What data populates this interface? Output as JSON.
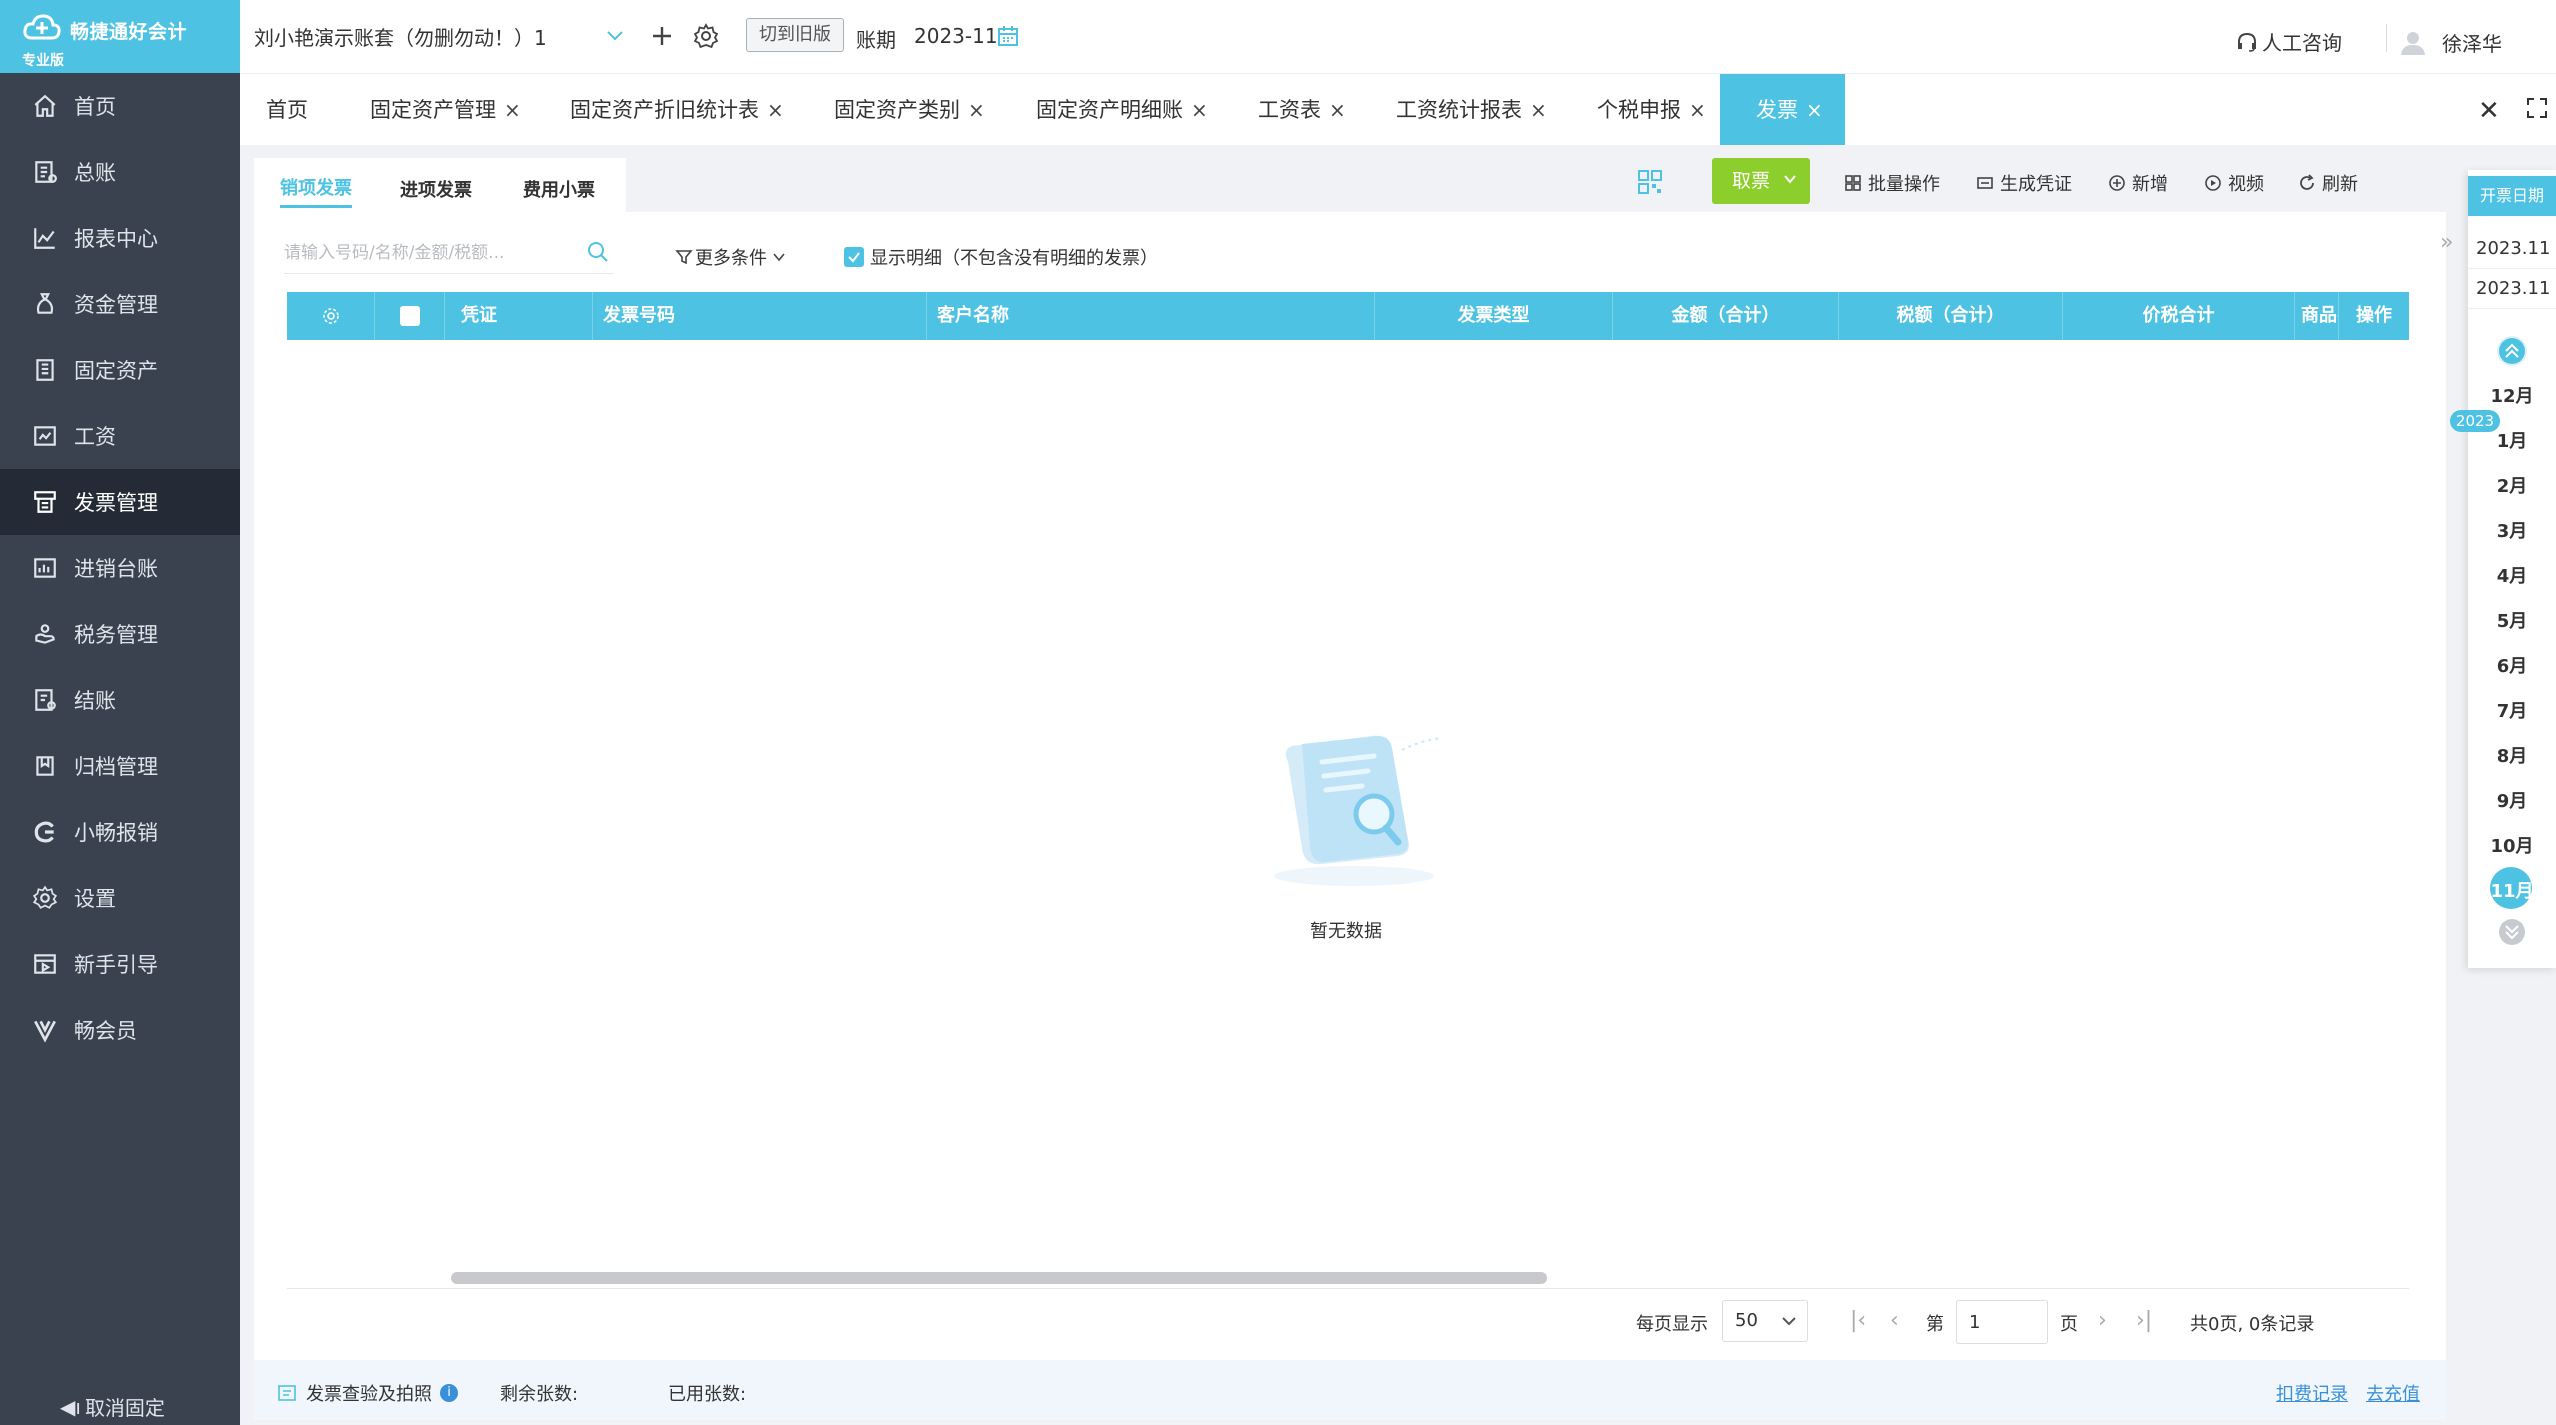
{
  "logo": {
    "name": "畅捷通好会计",
    "edition": "专业版"
  },
  "sidebar": {
    "items": [
      {
        "label": "首页",
        "icon": "home-icon"
      },
      {
        "label": "总账",
        "icon": "ledger-icon"
      },
      {
        "label": "报表中心",
        "icon": "report-chart-icon"
      },
      {
        "label": "资金管理",
        "icon": "money-bag-icon"
      },
      {
        "label": "固定资产",
        "icon": "building-icon"
      },
      {
        "label": "工资",
        "icon": "salary-icon"
      },
      {
        "label": "发票管理",
        "icon": "invoice-icon",
        "active": true
      },
      {
        "label": "进销台账",
        "icon": "inventory-icon"
      },
      {
        "label": "税务管理",
        "icon": "tax-hand-icon"
      },
      {
        "label": "结账",
        "icon": "checkout-icon"
      },
      {
        "label": "归档管理",
        "icon": "archive-icon"
      },
      {
        "label": "小畅报销",
        "icon": "reimburse-icon"
      },
      {
        "label": "设置",
        "icon": "gear-icon"
      },
      {
        "label": "新手引导",
        "icon": "guide-icon"
      },
      {
        "label": "畅会员",
        "icon": "vip-icon"
      }
    ],
    "unpin_label": "取消固定"
  },
  "topbar": {
    "account": "刘小艳演示账套（勿删勿动！）1",
    "switch_old": "切到旧版",
    "period_label": "账期",
    "period_value": "2023-11",
    "support": "人工咨询",
    "user": "徐泽华"
  },
  "tabs": [
    {
      "label": "首页",
      "closable": false
    },
    {
      "label": "固定资产管理",
      "closable": true
    },
    {
      "label": "固定资产折旧统计表",
      "closable": true
    },
    {
      "label": "固定资产类别",
      "closable": true
    },
    {
      "label": "固定资产明细账",
      "closable": true
    },
    {
      "label": "工资表",
      "closable": true
    },
    {
      "label": "工资统计报表",
      "closable": true
    },
    {
      "label": "个税申报",
      "closable": true
    },
    {
      "label": "发票",
      "closable": true,
      "active": true
    }
  ],
  "subtabs": [
    {
      "label": "销项发票",
      "active": true
    },
    {
      "label": "进项发票"
    },
    {
      "label": "费用小票"
    }
  ],
  "toolbar": {
    "fetch": "取票",
    "batch": "批量操作",
    "voucher": "生成凭证",
    "add": "新增",
    "video": "视频",
    "refresh": "刷新"
  },
  "filters": {
    "search_placeholder": "请输入号码/名称/金额/税额...",
    "more": "更多条件",
    "show_detail": "显示明细（不包含没有明细的发票）",
    "show_detail_checked": true
  },
  "table": {
    "columns": [
      "凭证",
      "发票号码",
      "客户名称",
      "发票类型",
      "金额（合计）",
      "税额（合计）",
      "价税合计",
      "商品名",
      "操作"
    ],
    "empty_text": "暂无数据"
  },
  "pager": {
    "per_page_label": "每页显示",
    "per_page": "50",
    "page_prefix": "第",
    "page_value": "1",
    "page_suffix": "页",
    "summary": "共0页, 0条记录"
  },
  "footer": {
    "check": "发票查验及拍照",
    "remaining": "剩余张数:",
    "used": "已用张数:",
    "deduct_record": "扣费记录",
    "recharge": "去充值"
  },
  "date_panel": {
    "title": "开票日期",
    "range_start": "2023.11",
    "range_end": "2023.11",
    "year": "2023",
    "months": [
      "12月",
      "1月",
      "2月",
      "3月",
      "4月",
      "5月",
      "6月",
      "7月",
      "8月",
      "9月",
      "10月",
      "11月"
    ],
    "active_month": "11月"
  },
  "colors": {
    "accent": "#4ec2e2",
    "sidebar": "#3a4250",
    "sidebar_active": "#252b36",
    "fetch_button": "#8ccf2c",
    "link": "#3a90d8"
  }
}
